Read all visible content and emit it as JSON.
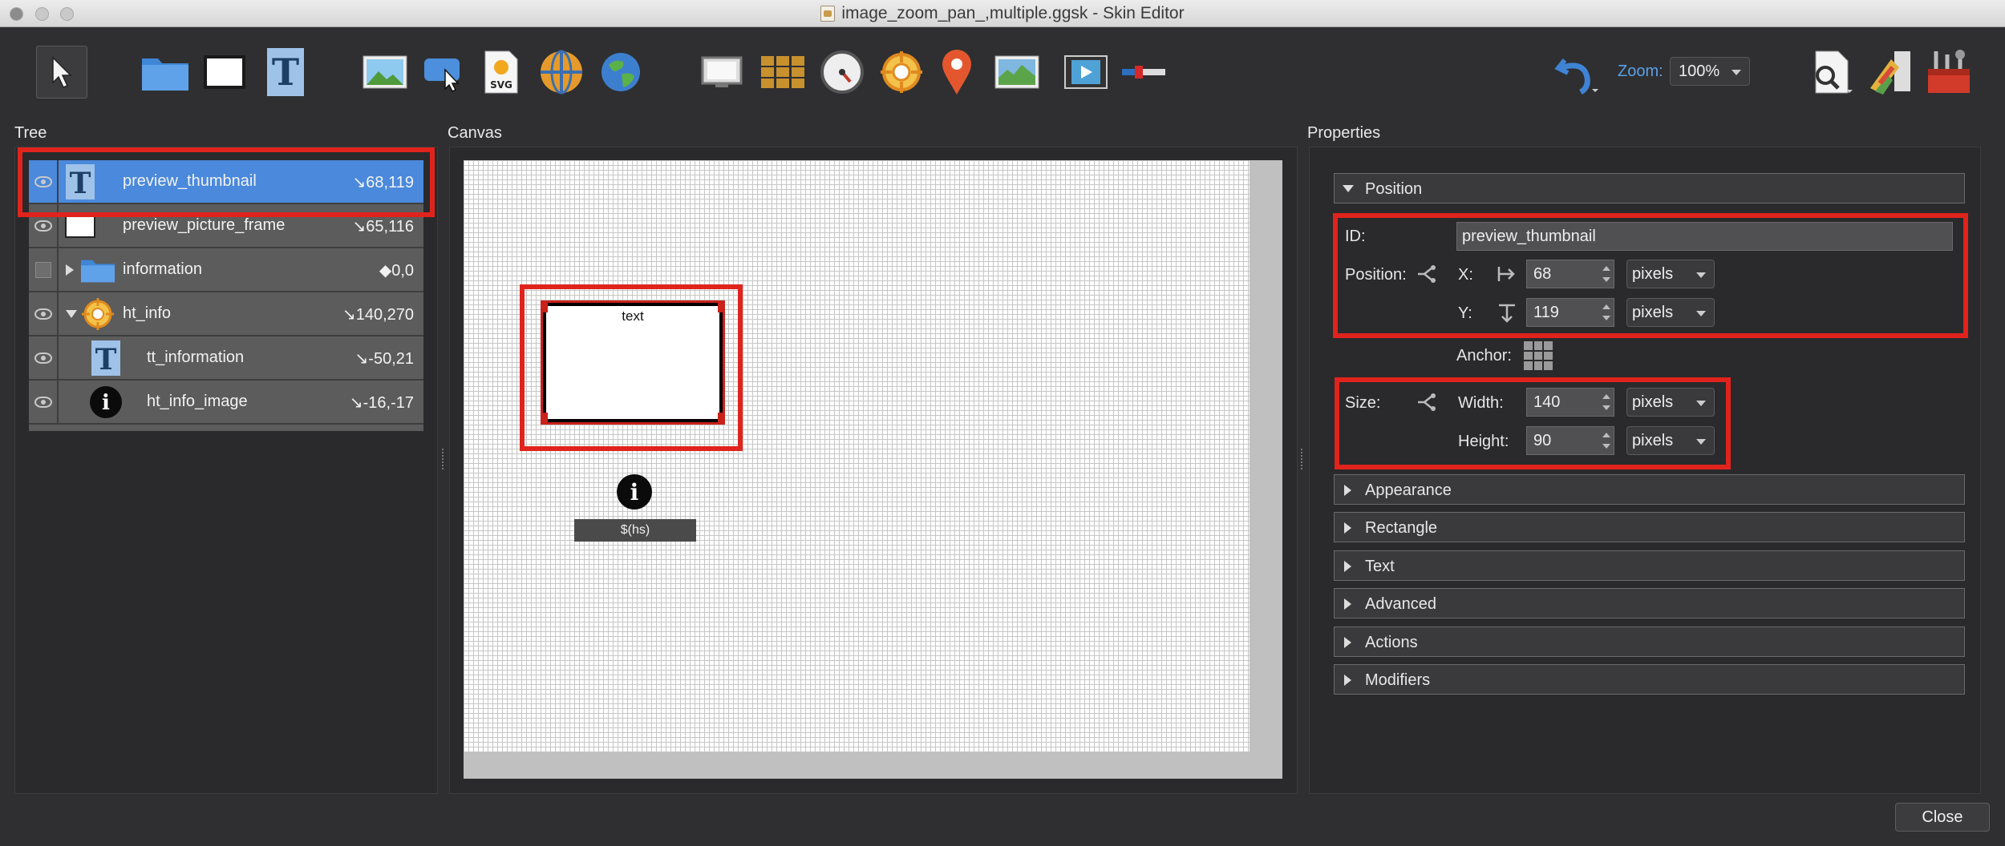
{
  "window": {
    "title": "image_zoom_pan_,multiple.ggsk - Skin Editor"
  },
  "toolbar": {
    "tools": [
      {
        "name": "select-pointer-tool",
        "icon": "pointer-arrow-icon"
      },
      {
        "name": "container-tool",
        "icon": "folder-icon"
      },
      {
        "name": "rectangle-tool",
        "icon": "rectangle-icon"
      },
      {
        "name": "text-tool",
        "icon": "text-t-icon"
      },
      {
        "name": "image-tool",
        "icon": "image-icon"
      },
      {
        "name": "button-tool",
        "icon": "button-cursor-icon"
      },
      {
        "name": "svg-tool",
        "icon": "svg-icon"
      },
      {
        "name": "panorama-tool",
        "icon": "sphere-icon"
      },
      {
        "name": "hotspot-tool",
        "icon": "globe-icon"
      },
      {
        "name": "screen-tool",
        "icon": "screen-icon"
      },
      {
        "name": "grid-tool",
        "icon": "grid-icon"
      },
      {
        "name": "compass-tool",
        "icon": "compass-icon"
      },
      {
        "name": "hotspot-target-tool",
        "icon": "target-icon"
      },
      {
        "name": "map-pin-tool",
        "icon": "map-pin-icon"
      },
      {
        "name": "map-tool",
        "icon": "map-icon"
      },
      {
        "name": "video-tool",
        "icon": "video-icon"
      },
      {
        "name": "slider-tool",
        "icon": "slider-icon"
      }
    ],
    "zoom_label": "Zoom:",
    "zoom_value": "100%"
  },
  "tree": {
    "title": "Tree",
    "rows": [
      {
        "label": "preview_thumbnail",
        "coord": "↘68,119",
        "icon": "text-t-icon",
        "indent": 0,
        "visible": true,
        "selected": true,
        "expander": ""
      },
      {
        "label": "preview_picture_frame",
        "coord": "↘65,116",
        "icon": "rectangle-icon",
        "indent": 0,
        "visible": true,
        "selected": false,
        "expander": ""
      },
      {
        "label": "information",
        "coord": "◆0,0",
        "icon": "folder-icon",
        "indent": 0,
        "visible": false,
        "selected": false,
        "expander": "right"
      },
      {
        "label": "ht_info",
        "coord": "↘140,270",
        "icon": "hotspot-target-icon",
        "indent": 0,
        "visible": true,
        "selected": false,
        "expander": "down"
      },
      {
        "label": "tt_information",
        "coord": "↘-50,21",
        "icon": "text-t-icon",
        "indent": 1,
        "visible": true,
        "selected": false,
        "expander": ""
      },
      {
        "label": "ht_info_image",
        "coord": "↘-16,-17",
        "icon": "info-circle-icon",
        "indent": 1,
        "visible": true,
        "selected": false,
        "expander": ""
      }
    ]
  },
  "canvas": {
    "title": "Canvas",
    "element_text": "text",
    "info_glyph": "i",
    "hotspot_text": "$(hs)"
  },
  "properties": {
    "title": "Properties",
    "sections": {
      "position": "Position",
      "appearance": "Appearance",
      "rectangle": "Rectangle",
      "text": "Text",
      "advanced": "Advanced",
      "actions": "Actions",
      "modifiers": "Modifiers"
    },
    "id_label": "ID:",
    "id_value": "preview_thumbnail",
    "position_label": "Position:",
    "x_label": "X:",
    "x_value": "68",
    "x_unit": "pixels",
    "y_label": "Y:",
    "y_value": "119",
    "y_unit": "pixels",
    "anchor_label": "Anchor:",
    "size_label": "Size:",
    "width_label": "Width:",
    "width_value": "140",
    "width_unit": "pixels",
    "height_label": "Height:",
    "height_value": "90",
    "height_unit": "pixels"
  },
  "footer": {
    "close_label": "Close"
  },
  "colors": {
    "background": "#2f2f31",
    "selection": "#4a89dc",
    "highlight": "#e0231c",
    "zoom_accent": "#5aa0e8"
  }
}
